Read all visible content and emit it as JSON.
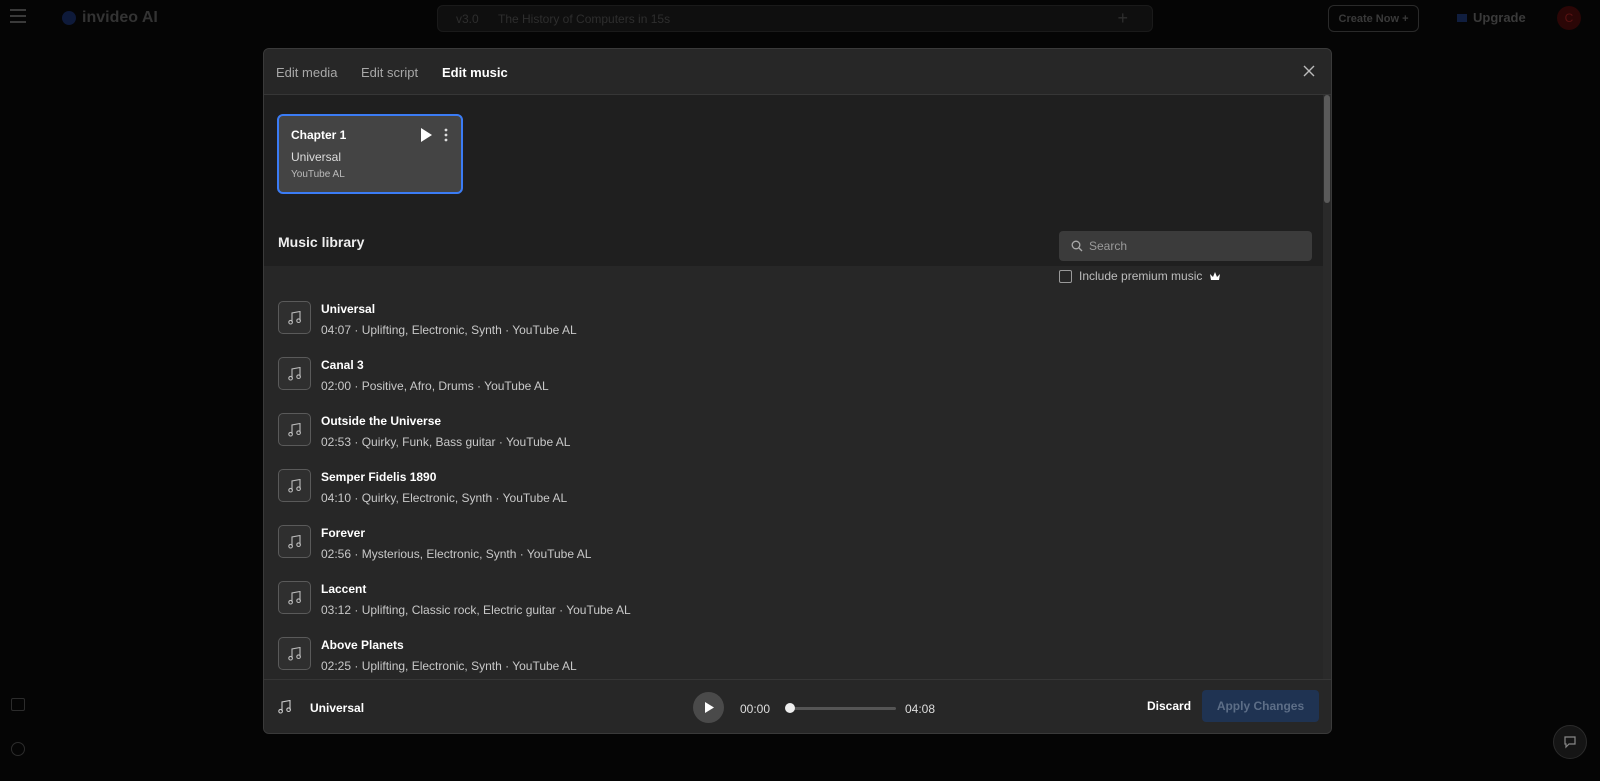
{
  "app": {
    "logo_text": "invideo AI",
    "version": "v3.0",
    "project_title": "The History of Computers in 15s",
    "create_now": "Create Now +",
    "upgrade": "Upgrade",
    "avatar_initial": "C"
  },
  "modal": {
    "tabs": [
      {
        "label": "Edit media",
        "active": false
      },
      {
        "label": "Edit script",
        "active": false
      },
      {
        "label": "Edit music",
        "active": true
      }
    ],
    "chapter": {
      "title": "Chapter 1",
      "track": "Universal",
      "source": "YouTube AL"
    },
    "library": {
      "title": "Music library",
      "search_placeholder": "Search",
      "premium_label": "Include premium music",
      "premium_checked": false
    },
    "tracks": [
      {
        "name": "Universal",
        "meta": "04:07 · Uplifting, Electronic, Synth · YouTube AL"
      },
      {
        "name": "Canal 3",
        "meta": "02:00 · Positive, Afro, Drums · YouTube AL"
      },
      {
        "name": "Outside the Universe",
        "meta": "02:53 · Quirky, Funk, Bass guitar · YouTube AL"
      },
      {
        "name": "Semper Fidelis 1890",
        "meta": "04:10 · Quirky, Electronic, Synth · YouTube AL"
      },
      {
        "name": "Forever",
        "meta": "02:56 · Mysterious, Electronic, Synth · YouTube AL"
      },
      {
        "name": "Laccent",
        "meta": "03:12 · Uplifting, Classic rock, Electric guitar · YouTube AL"
      },
      {
        "name": "Above Planets",
        "meta": "02:25 · Uplifting, Electronic, Synth · YouTube AL"
      }
    ],
    "player": {
      "track": "Universal",
      "current_time": "00:00",
      "duration": "04:08",
      "progress": 0
    },
    "actions": {
      "discard": "Discard",
      "apply": "Apply Changes"
    }
  },
  "colors": {
    "accent_border": "#3b7cf5",
    "apply_bg": "#1f3352",
    "modal_bg": "#272727"
  }
}
